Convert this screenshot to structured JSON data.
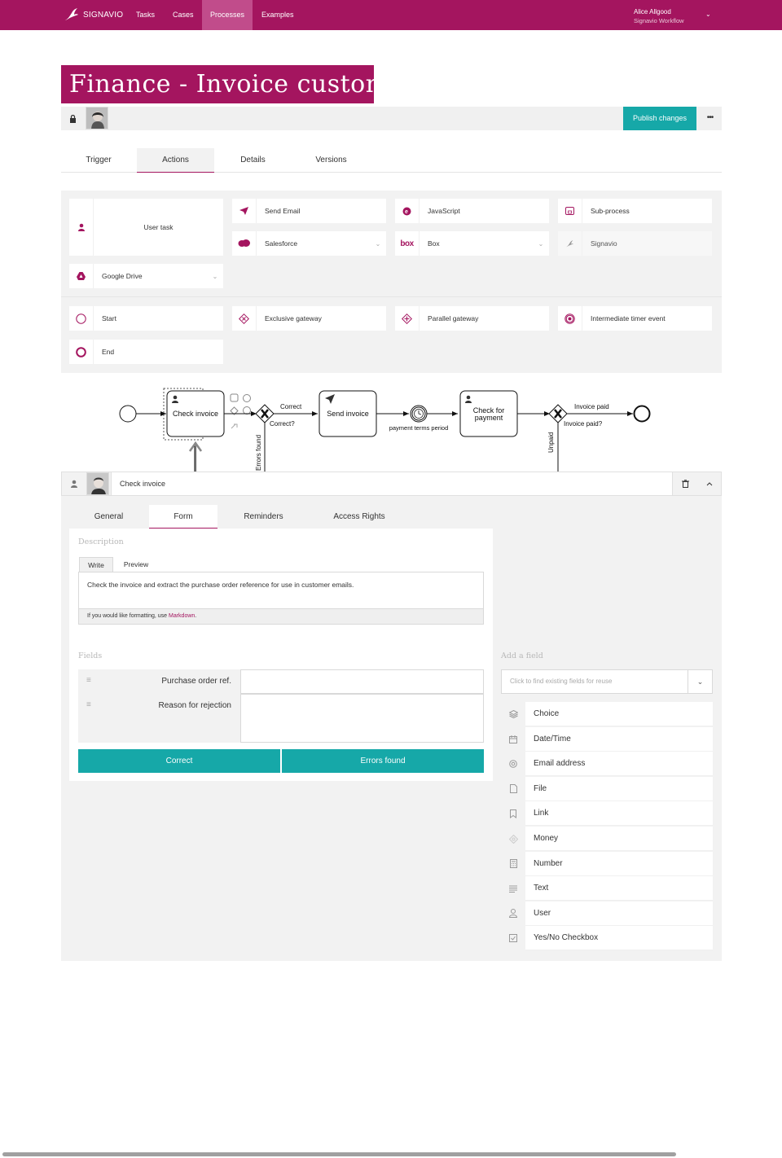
{
  "nav": {
    "brand": "SIGNAVIO",
    "items": [
      "Tasks",
      "Cases",
      "Processes",
      "Examples"
    ],
    "active": "Processes",
    "user_name": "Alice Allgood",
    "user_org": "Signavio Workflow"
  },
  "process": {
    "title": "Finance - Invoice customer",
    "publish_label": "Publish changes",
    "more_label": "•••"
  },
  "process_tabs": [
    "Trigger",
    "Actions",
    "Details",
    "Versions"
  ],
  "process_tabs_active": "Actions",
  "palette": {
    "user_task": "User task",
    "send_email": "Send Email",
    "javascript": "JavaScript",
    "sub_process": "Sub-process",
    "salesforce": "Salesforce",
    "box": "Box",
    "signavio": "Signavio",
    "google_drive": "Google Drive",
    "start": "Start",
    "exclusive_gateway": "Exclusive gateway",
    "parallel_gateway": "Parallel gateway",
    "intermediate_timer": "Intermediate timer event",
    "end": "End"
  },
  "diagram": {
    "task_check_invoice": "Check invoice",
    "gateway1_out_correct": "Correct",
    "gateway1_question": "Correct?",
    "gateway1_out_errors": "Errors found",
    "task_send_invoice": "Send invoice",
    "timer_label": "payment terms period",
    "task_check_payment_l1": "Check for",
    "task_check_payment_l2": "payment",
    "gateway2_out_paid": "Invoice paid",
    "gateway2_question": "Invoice paid?",
    "gateway2_out_unpaid": "Unpaid"
  },
  "task": {
    "name": "Check invoice",
    "tabs": [
      "General",
      "Form",
      "Reminders",
      "Access Rights"
    ],
    "active_tab": "Form",
    "description_label": "Description",
    "write_label": "Write",
    "preview_label": "Preview",
    "description": "Check the invoice and extract the purchase order reference for use in customer emails.",
    "markdown_note": "If you would like formatting, use ",
    "markdown_link": "Markdown",
    "markdown_end": ".",
    "fields_label": "Fields",
    "fields": [
      "Purchase order ref.",
      "Reason for rejection"
    ],
    "outcomes": [
      "Correct",
      "Errors found"
    ],
    "add_field_label": "Add a field",
    "add_field_placeholder": "Click to find existing fields for reuse",
    "field_types": [
      {
        "label": "Choice",
        "icon": "layers-icon"
      },
      {
        "label": "Date/Time",
        "icon": "calendar-icon"
      },
      {
        "label": "Email address",
        "icon": "at-icon"
      },
      {
        "label": "File",
        "icon": "file-icon"
      },
      {
        "label": "Link",
        "icon": "bookmark-icon"
      },
      {
        "label": "Money",
        "icon": "money-icon"
      },
      {
        "label": "Number",
        "icon": "calculator-icon"
      },
      {
        "label": "Text",
        "icon": "text-lines-icon"
      },
      {
        "label": "User",
        "icon": "user-icon"
      },
      {
        "label": "Yes/No Checkbox",
        "icon": "checkbox-icon"
      }
    ]
  },
  "colors": {
    "brand": "#a4155f",
    "teal": "#16a8a8"
  }
}
